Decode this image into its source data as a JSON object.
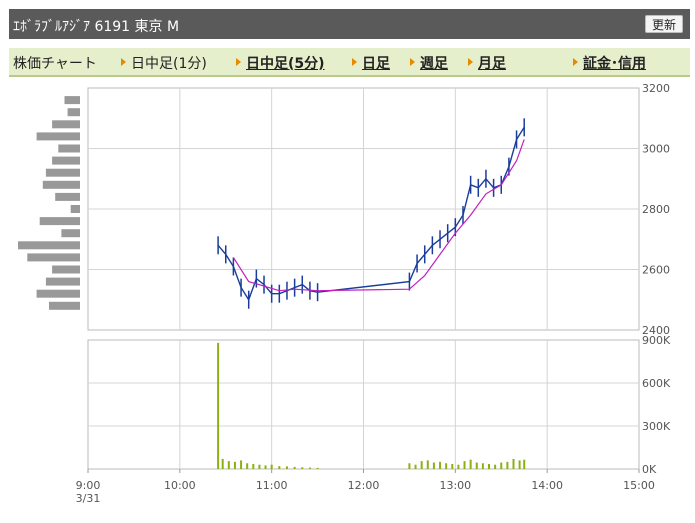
{
  "header": {
    "title": "ｴﾎﾞﾗﾌﾞﾙｱｼﾞｱ  6191  東京 M",
    "refresh_label": "更新"
  },
  "tabs": [
    {
      "label": "株価チャート",
      "arrow": false,
      "link": false
    },
    {
      "label": "日中足(1分)",
      "arrow": true,
      "link": false
    },
    {
      "label": "日中足(5分)",
      "arrow": true,
      "link": true
    },
    {
      "label": "日足",
      "arrow": true,
      "link": true
    },
    {
      "label": "週足",
      "arrow": true,
      "link": true
    },
    {
      "label": "月足",
      "arrow": true,
      "link": true
    },
    {
      "label": "証金･信用",
      "arrow": true,
      "link": true
    }
  ],
  "colors": {
    "candle": "#1a3c9a",
    "moving_average": "#c020c0",
    "volume": "#8db010",
    "volume_profile": "#999999",
    "grid": "#d4d4d4"
  },
  "chart_data": {
    "type": "line",
    "title": "",
    "x_ticks": [
      "9:00",
      "10:00",
      "11:00",
      "12:00",
      "13:00",
      "14:00",
      "15:00"
    ],
    "x_tick_sub": "3/31",
    "price": {
      "ylim": [
        2400,
        3200
      ],
      "y_ticks": [
        "2400",
        "2600",
        "2800",
        "3000",
        "3200"
      ],
      "series": [
        {
          "time": "10:25",
          "value": 2680
        },
        {
          "time": "10:30",
          "value": 2650
        },
        {
          "time": "10:35",
          "value": 2610
        },
        {
          "time": "10:40",
          "value": 2540
        },
        {
          "time": "10:45",
          "value": 2500
        },
        {
          "time": "10:50",
          "value": 2570
        },
        {
          "time": "10:55",
          "value": 2550
        },
        {
          "time": "11:00",
          "value": 2520
        },
        {
          "time": "11:05",
          "value": 2520
        },
        {
          "time": "11:10",
          "value": 2530
        },
        {
          "time": "11:15",
          "value": 2540
        },
        {
          "time": "11:20",
          "value": 2550
        },
        {
          "time": "11:25",
          "value": 2530
        },
        {
          "time": "11:30",
          "value": 2525
        },
        {
          "time": "12:30",
          "value": 2560
        },
        {
          "time": "12:35",
          "value": 2620
        },
        {
          "time": "12:40",
          "value": 2650
        },
        {
          "time": "12:45",
          "value": 2680
        },
        {
          "time": "12:50",
          "value": 2700
        },
        {
          "time": "12:55",
          "value": 2720
        },
        {
          "time": "13:00",
          "value": 2740
        },
        {
          "time": "13:05",
          "value": 2780
        },
        {
          "time": "13:10",
          "value": 2880
        },
        {
          "time": "13:15",
          "value": 2870
        },
        {
          "time": "13:20",
          "value": 2900
        },
        {
          "time": "13:25",
          "value": 2870
        },
        {
          "time": "13:30",
          "value": 2880
        },
        {
          "time": "13:35",
          "value": 2940
        },
        {
          "time": "13:40",
          "value": 3030
        },
        {
          "time": "13:45",
          "value": 3070
        }
      ],
      "moving_average": [
        {
          "time": "10:35",
          "value": 2640
        },
        {
          "time": "10:45",
          "value": 2560
        },
        {
          "time": "10:55",
          "value": 2545
        },
        {
          "time": "11:05",
          "value": 2530
        },
        {
          "time": "11:15",
          "value": 2535
        },
        {
          "time": "11:30",
          "value": 2530
        },
        {
          "time": "12:30",
          "value": 2535
        },
        {
          "time": "12:40",
          "value": 2580
        },
        {
          "time": "12:50",
          "value": 2650
        },
        {
          "time": "13:00",
          "value": 2720
        },
        {
          "time": "13:10",
          "value": 2780
        },
        {
          "time": "13:20",
          "value": 2850
        },
        {
          "time": "13:30",
          "value": 2880
        },
        {
          "time": "13:40",
          "value": 2960
        },
        {
          "time": "13:45",
          "value": 3030
        }
      ]
    },
    "volume": {
      "ylim": [
        0,
        900000
      ],
      "y_ticks": [
        "0K",
        "300K",
        "600K",
        "900K"
      ],
      "series": [
        {
          "time": "10:25",
          "value": 880000
        },
        {
          "time": "10:28",
          "value": 70000
        },
        {
          "time": "10:32",
          "value": 55000
        },
        {
          "time": "10:36",
          "value": 50000
        },
        {
          "time": "10:40",
          "value": 60000
        },
        {
          "time": "10:44",
          "value": 40000
        },
        {
          "time": "10:48",
          "value": 35000
        },
        {
          "time": "10:52",
          "value": 30000
        },
        {
          "time": "10:56",
          "value": 25000
        },
        {
          "time": "11:00",
          "value": 30000
        },
        {
          "time": "11:05",
          "value": 20000
        },
        {
          "time": "11:10",
          "value": 18000
        },
        {
          "time": "11:15",
          "value": 15000
        },
        {
          "time": "11:20",
          "value": 12000
        },
        {
          "time": "11:25",
          "value": 10000
        },
        {
          "time": "11:30",
          "value": 8000
        },
        {
          "time": "12:30",
          "value": 40000
        },
        {
          "time": "12:34",
          "value": 30000
        },
        {
          "time": "12:38",
          "value": 55000
        },
        {
          "time": "12:42",
          "value": 60000
        },
        {
          "time": "12:46",
          "value": 45000
        },
        {
          "time": "12:50",
          "value": 50000
        },
        {
          "time": "12:54",
          "value": 40000
        },
        {
          "time": "12:58",
          "value": 35000
        },
        {
          "time": "13:02",
          "value": 30000
        },
        {
          "time": "13:06",
          "value": 55000
        },
        {
          "time": "13:10",
          "value": 65000
        },
        {
          "time": "13:14",
          "value": 45000
        },
        {
          "time": "13:18",
          "value": 40000
        },
        {
          "time": "13:22",
          "value": 35000
        },
        {
          "time": "13:26",
          "value": 30000
        },
        {
          "time": "13:30",
          "value": 45000
        },
        {
          "time": "13:34",
          "value": 50000
        },
        {
          "time": "13:38",
          "value": 70000
        },
        {
          "time": "13:42",
          "value": 60000
        },
        {
          "time": "13:45",
          "value": 65000
        }
      ]
    },
    "volume_profile": [
      {
        "price": 3160,
        "value": 0.25
      },
      {
        "price": 3120,
        "value": 0.2
      },
      {
        "price": 3080,
        "value": 0.45
      },
      {
        "price": 3040,
        "value": 0.7
      },
      {
        "price": 3000,
        "value": 0.35
      },
      {
        "price": 2960,
        "value": 0.45
      },
      {
        "price": 2920,
        "value": 0.55
      },
      {
        "price": 2880,
        "value": 0.6
      },
      {
        "price": 2840,
        "value": 0.4
      },
      {
        "price": 2800,
        "value": 0.15
      },
      {
        "price": 2760,
        "value": 0.65
      },
      {
        "price": 2720,
        "value": 0.3
      },
      {
        "price": 2680,
        "value": 1.0
      },
      {
        "price": 2640,
        "value": 0.85
      },
      {
        "price": 2600,
        "value": 0.45
      },
      {
        "price": 2560,
        "value": 0.55
      },
      {
        "price": 2520,
        "value": 0.7
      },
      {
        "price": 2480,
        "value": 0.5
      }
    ]
  }
}
